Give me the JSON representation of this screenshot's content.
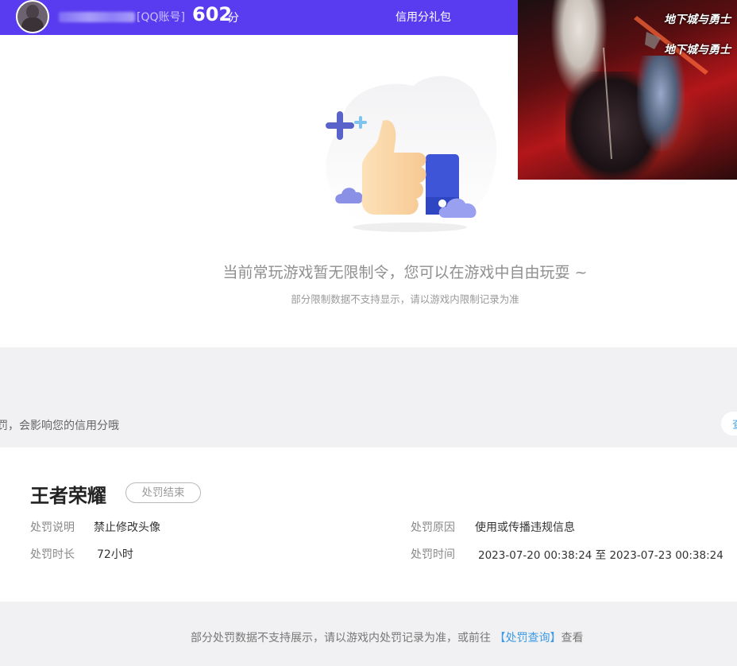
{
  "header": {
    "account_tag": "[QQ账号]",
    "score": "602",
    "score_unit": "分",
    "gift_link": "信用分礼包"
  },
  "ad": {
    "logo_text": "地下城与勇士"
  },
  "empty_state": {
    "title": "当前常玩游戏暂无限制令，您可以在游戏中自由玩耍 ~",
    "subtitle": "部分限制数据不支持显示，请以游戏内限制记录为准"
  },
  "notice": {
    "text": "罚，会影响您的信用分哦",
    "button_label": "查"
  },
  "record": {
    "game_name": "王者荣耀",
    "status_badge": "处罚结束",
    "fields": [
      {
        "label": "处罚说明",
        "value": "禁止修改头像"
      },
      {
        "label": "处罚原因",
        "value": "使用或传播违规信息"
      },
      {
        "label": "处罚时长",
        "value": "72小时"
      },
      {
        "label": "处罚时间",
        "value": "2023-07-20 00:38:24 至 2023-07-23 00:38:24"
      }
    ]
  },
  "footer": {
    "prefix": "部分处罚数据不支持展示，请以游戏内处罚记录为准，或前往 ",
    "link": "【处罚查询】",
    "suffix": "查看"
  },
  "colors": {
    "header_bg": "#5a3cf0",
    "link_blue": "#3b9be6",
    "band_gray": "#f1f1f3"
  }
}
